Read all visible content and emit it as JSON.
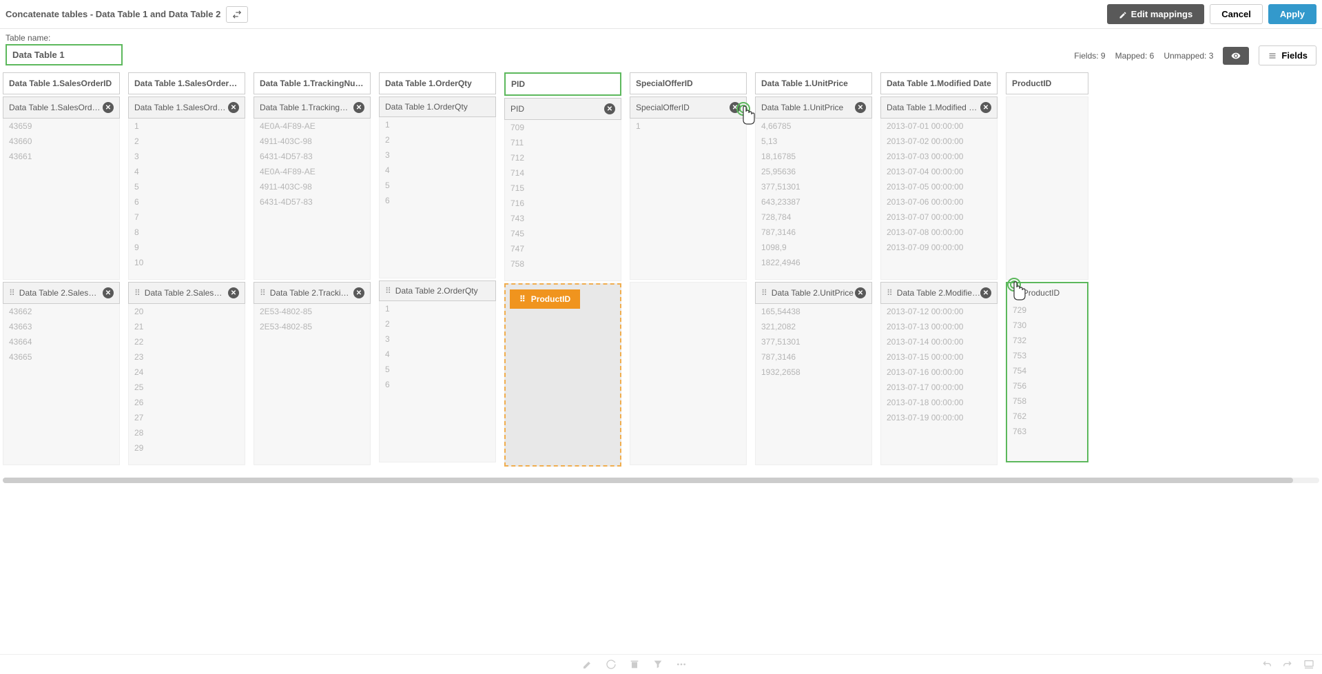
{
  "header": {
    "title": "Concatenate tables - Data Table 1 and Data Table 2",
    "edit_mappings": "Edit mappings",
    "cancel": "Cancel",
    "apply": "Apply"
  },
  "table_name": {
    "label": "Table name:",
    "value": "Data Table 1"
  },
  "stats": {
    "fields_label": "Fields:",
    "fields": "9",
    "mapped_label": "Mapped:",
    "mapped": "6",
    "unmapped_label": "Unmapped:",
    "unmapped": "3",
    "fields_btn": "Fields"
  },
  "drag_chip": "ProductID",
  "columns": [
    {
      "header": "Data Table 1.SalesOrderID",
      "highlight": false,
      "t1": {
        "label": "Data Table 1.SalesOrderID",
        "close": true,
        "drag": false,
        "data": [
          "43659",
          "43660",
          "43661"
        ]
      },
      "t2": {
        "label": "Data Table 2.SalesOrd...",
        "close": true,
        "drag": true,
        "data": [
          "43662",
          "43663",
          "43664",
          "43665"
        ]
      }
    },
    {
      "header": "Data Table 1.SalesOrderDeta...",
      "highlight": false,
      "t1": {
        "label": "Data Table 1.SalesOrderD...",
        "close": true,
        "drag": false,
        "data": [
          "1",
          "2",
          "3",
          "4",
          "5",
          "6",
          "7",
          "8",
          "9",
          "10"
        ]
      },
      "t2": {
        "label": "Data Table 2.SalesOrd...",
        "close": true,
        "drag": true,
        "data": [
          "20",
          "21",
          "22",
          "23",
          "24",
          "25",
          "26",
          "27",
          "28",
          "29"
        ]
      }
    },
    {
      "header": "Data Table 1.TrackingNumber",
      "highlight": false,
      "t1": {
        "label": "Data Table 1.TrackingNum...",
        "close": true,
        "drag": false,
        "data": [
          "4E0A-4F89-AE",
          "4911-403C-98",
          "6431-4D57-83",
          "4E0A-4F89-AE",
          "4911-403C-98",
          "6431-4D57-83"
        ]
      },
      "t2": {
        "label": "Data Table 2.Tracking...",
        "close": true,
        "drag": true,
        "data": [
          "2E53-4802-85",
          "2E53-4802-85"
        ]
      }
    },
    {
      "header": "Data Table 1.OrderQty",
      "highlight": false,
      "t1": {
        "label": "Data Table 1.OrderQty",
        "close": false,
        "drag": false,
        "data": [
          "1",
          "2",
          "3",
          "4",
          "5",
          "6"
        ]
      },
      "t2": {
        "label": "Data Table 2.OrderQty",
        "close": false,
        "drag": true,
        "data": [
          "1",
          "2",
          "3",
          "4",
          "5",
          "6"
        ]
      }
    },
    {
      "header": "PID",
      "highlight": true,
      "t1": {
        "label": "PID",
        "close": true,
        "drag": false,
        "data": [
          "709",
          "711",
          "712",
          "714",
          "715",
          "716",
          "743",
          "745",
          "747",
          "758"
        ]
      },
      "t2": {
        "drop": true
      }
    },
    {
      "header": "SpecialOfferID",
      "highlight": false,
      "t1": {
        "label": "SpecialOfferID",
        "close": true,
        "drag": false,
        "data": [
          "1"
        ],
        "cursor": true
      },
      "t2": {
        "empty": true
      }
    },
    {
      "header": "Data Table 1.UnitPrice",
      "highlight": false,
      "t1": {
        "label": "Data Table 1.UnitPrice",
        "close": true,
        "drag": false,
        "data": [
          "4,66785",
          "5,13",
          "18,16785",
          "25,95636",
          "377,51301",
          "643,23387",
          "728,784",
          "787,3146",
          "1098,9",
          "1822,4946"
        ]
      },
      "t2": {
        "label": "Data Table 2.UnitPrice",
        "close": true,
        "drag": true,
        "data": [
          "165,54438",
          "321,2082",
          "377,51301",
          "787,3146",
          "1932,2658"
        ]
      }
    },
    {
      "header": "Data Table 1.Modified Date",
      "highlight": false,
      "t1": {
        "label": "Data Table 1.Modified Date",
        "close": true,
        "drag": false,
        "data": [
          "2013-07-01 00:00:00",
          "2013-07-02 00:00:00",
          "2013-07-03 00:00:00",
          "2013-07-04 00:00:00",
          "2013-07-05 00:00:00",
          "2013-07-06 00:00:00",
          "2013-07-07 00:00:00",
          "2013-07-08 00:00:00",
          "2013-07-09 00:00:00"
        ]
      },
      "t2": {
        "label": "Data Table 2.Modified ...",
        "close": true,
        "drag": true,
        "data": [
          "2013-07-12 00:00:00",
          "2013-07-13 00:00:00",
          "2013-07-14 00:00:00",
          "2013-07-15 00:00:00",
          "2013-07-16 00:00:00",
          "2013-07-17 00:00:00",
          "2013-07-18 00:00:00",
          "2013-07-19 00:00:00"
        ]
      }
    },
    {
      "header": "ProductID",
      "highlight": false,
      "unmapped": {
        "label": "ProductID",
        "data": [
          "729",
          "730",
          "732",
          "753",
          "754",
          "756",
          "758",
          "762",
          "763"
        ],
        "cursor": true
      }
    }
  ]
}
